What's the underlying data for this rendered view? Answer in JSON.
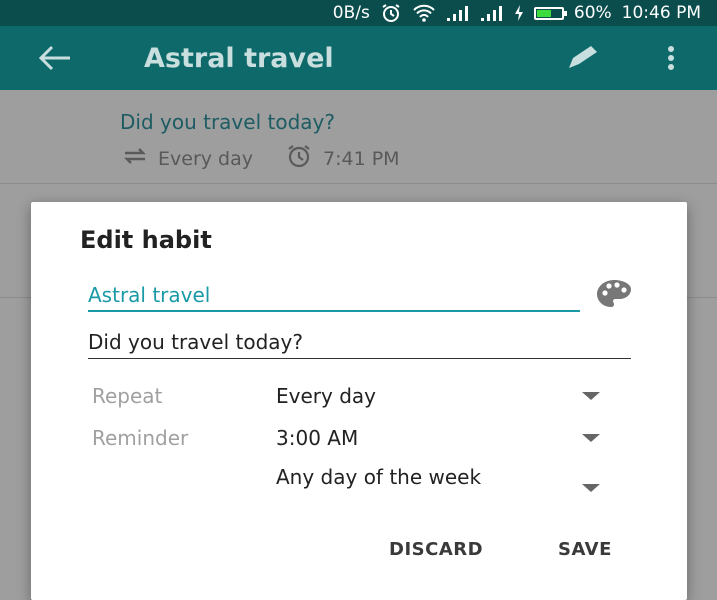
{
  "status_bar": {
    "network_speed": "0B/s",
    "battery_percent": "60%",
    "battery_level": 0.6,
    "time": "10:46 PM",
    "icons": [
      "alarm-icon",
      "wifi-icon",
      "signal-icon",
      "signal-icon",
      "charging-icon",
      "battery-icon"
    ]
  },
  "app_bar": {
    "title": "Astral travel",
    "icons": [
      "back-arrow-icon",
      "edit-pencil-icon",
      "more-vert-icon"
    ]
  },
  "background": {
    "question": "Did you travel today?",
    "frequency": "Every day",
    "reminder_time": "7:41 PM",
    "icons": [
      "repeat-icon",
      "alarm-icon"
    ]
  },
  "dialog": {
    "title": "Edit habit",
    "name_value": "Astral travel",
    "question_value": "Did you travel today?",
    "repeat_label": "Repeat",
    "repeat_value": "Every day",
    "reminder_label": "Reminder",
    "reminder_value": "3:00 AM",
    "reminder_days_value": "Any day of the week",
    "discard_label": "DISCARD",
    "save_label": "SAVE",
    "accent_color": "#1a9aa6",
    "icons": [
      "palette-icon",
      "dropdown-arrow-icon"
    ]
  }
}
